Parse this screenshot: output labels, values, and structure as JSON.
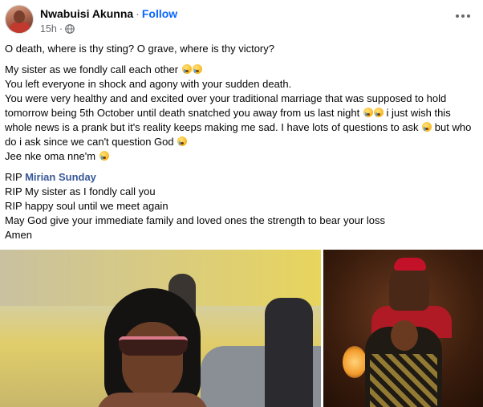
{
  "post": {
    "author_name": "Nwabuisi Akunna",
    "separator": "·",
    "follow_label": "Follow",
    "timestamp": "15h",
    "separator2": "·",
    "more_icon": "more-horizontal-icon",
    "privacy_icon": "globe-icon"
  },
  "content": {
    "line1": "O death, where is thy sting? O grave, where is thy victory?",
    "line2": "My sister as we fondly call each other",
    "line3": "You left everyone in shock and agony with your sudden death.",
    "line4a": "You were very healthy and and excited over your traditional marriage that was supposed to hold tomorrow being 5th October until death snatched you away from us last night",
    "line4b": "i just wish this whole news is a prank but it's reality keeps making me sad. I have lots of questions to ask",
    "line4c": "but who do i ask since we can't question God",
    "line5": "Jee nke oma nne'm",
    "rip_prefix": "RIP",
    "rip_mention": "Mirian Sunday",
    "line7": "RIP My sister as I fondly call you",
    "line8": "RIP happy soul until we meet again",
    "line9": "May God give your immediate family and loved ones the strength to bear your loss",
    "line10": "Amen",
    "emoji": "crying-face-icon"
  },
  "photos": {
    "left_photo": "woman-with-braids-and-sunglasses-photo",
    "right_photo": "couple-in-traditional-attire-photo"
  },
  "colors": {
    "follow": "#0866ff",
    "mention": "#385898",
    "secondary_text": "#65676b"
  }
}
